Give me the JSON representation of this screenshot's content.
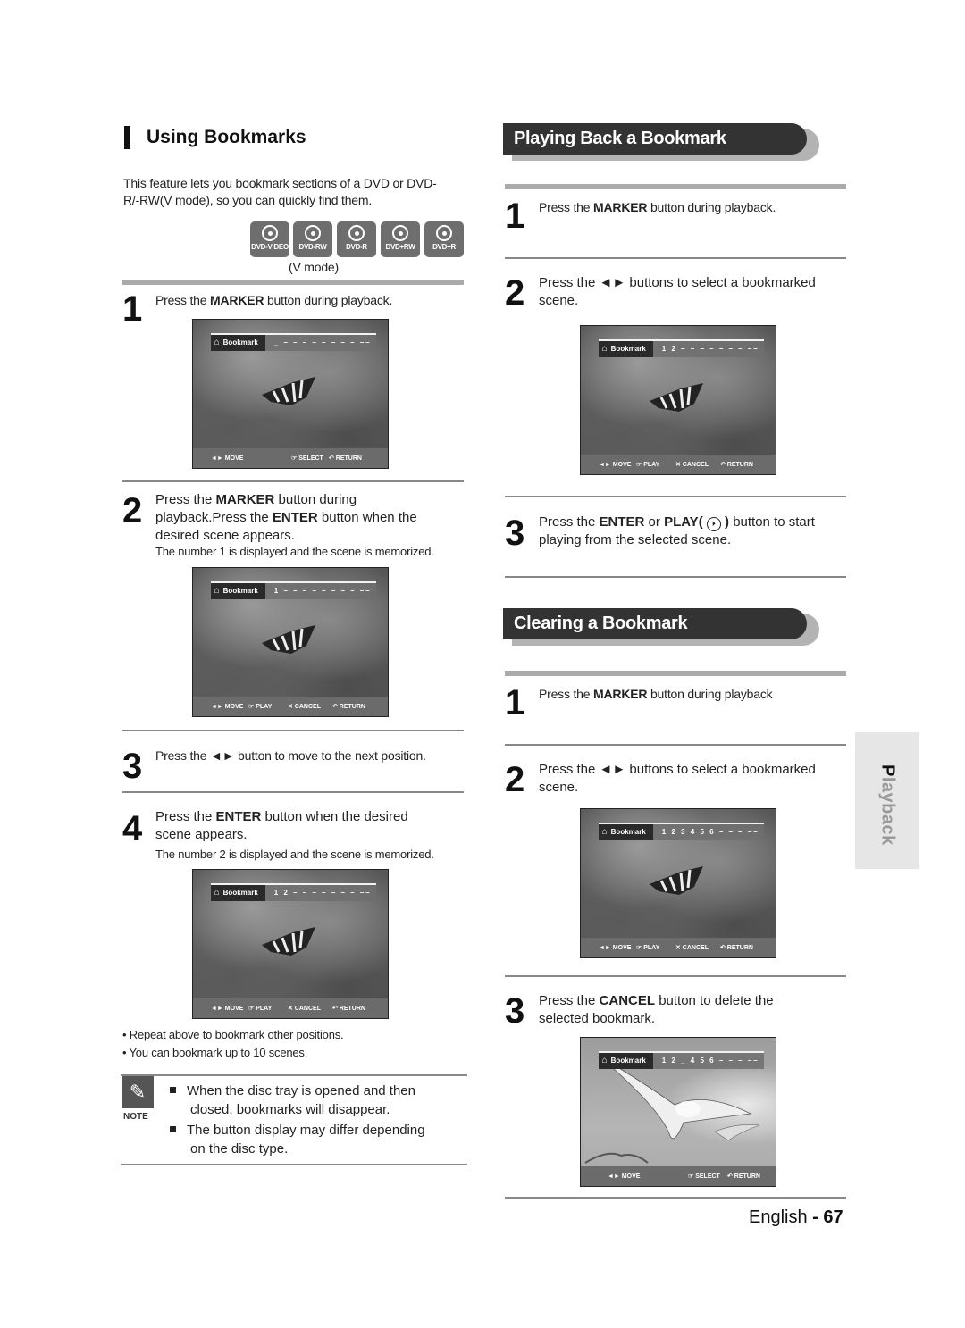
{
  "left": {
    "title": "Using Bookmarks",
    "intro": "This feature lets you bookmark sections of a DVD or DVD-R/-RW(V mode), so you can quickly find them.",
    "intro_line1": "This feature lets you bookmark sections of a DVD or DVD-",
    "intro_line2": "R/-RW(V mode), so you can quickly find them.",
    "disc_types": [
      "DVD-VIDEO",
      "DVD-RW",
      "DVD-R",
      "DVD+RW",
      "DVD+R"
    ],
    "disc_caption": "(V mode)",
    "steps": [
      {
        "num": "1",
        "pre": "Press the ",
        "bold": "MARKER",
        "post": " button during playback."
      },
      {
        "num": "2",
        "line1_pre": "Press the ",
        "line1_bold": "MARKER",
        "line1_post": " button during",
        "line2_pre": "playback.Press the ",
        "line2_bold": "ENTER",
        "line2_post": " button when the",
        "line3": "desired scene appears.",
        "note": "The number 1 is displayed and the scene is memorized."
      },
      {
        "num": "3",
        "pre": "Press the ",
        "arrows": "◄►",
        "post": " button to move to the next position."
      },
      {
        "num": "4",
        "line1_pre": "Press the ",
        "line1_bold": "ENTER",
        "line1_post": " button when the desired",
        "line2": "scene appears.",
        "note": "The number 2 is displayed and the scene is memorized."
      }
    ],
    "bullets": [
      "• Repeat above to bookmark other positions.",
      "• You can bookmark up to 10 scenes."
    ],
    "note_label": "NOTE",
    "notes": [
      {
        "line1": "When the disc tray is opened and then",
        "line2": "closed, bookmarks will disappear."
      },
      {
        "line1": "The button display may differ depending",
        "line2": "on the disc type."
      }
    ]
  },
  "screens": {
    "bookmark_label": "Bookmark",
    "s1": {
      "slots": "_ – – – – – – – – ––",
      "buttons": [
        "◄► MOVE",
        "☞ SELECT",
        "↶ RETURN"
      ]
    },
    "s2": {
      "slots": "1 – – – – – – – – ––",
      "buttons": [
        "◄► MOVE",
        "☞ PLAY",
        "✕ CANCEL",
        "↶ RETURN"
      ]
    },
    "s3": {
      "slots": "1 2 – – – – – – – ––",
      "buttons": [
        "◄► MOVE",
        "☞ PLAY",
        "✕ CANCEL",
        "↶ RETURN"
      ]
    },
    "s4": {
      "slots": "1 2 – – – – – – – ––",
      "buttons": [
        "◄► MOVE",
        "☞ PLAY",
        "✕ CANCEL",
        "↶ RETURN"
      ]
    },
    "s5": {
      "slots": "1 2 3 4 5 6 – – – ––",
      "buttons": [
        "◄► MOVE",
        "☞ PLAY",
        "✕ CANCEL",
        "↶ RETURN"
      ]
    },
    "s6": {
      "slots": "1 2 _ 4 5 6 – – – ––",
      "buttons": [
        "◄► MOVE",
        "☞ SELECT",
        "↶ RETURN"
      ]
    }
  },
  "right": {
    "section1_title": "Playing Back a Bookmark",
    "s1_steps": [
      {
        "num": "1",
        "pre": "Press the ",
        "bold": "MARKER",
        "post": " button during playback."
      },
      {
        "num": "2",
        "line1": "Press the ◄► buttons to select a bookmarked",
        "line2": "scene."
      },
      {
        "num": "3",
        "line1_pre": "Press the ",
        "line1_bold": "ENTER",
        "line1_mid": " or ",
        "line1_bold2": "PLAY(",
        "play_icon": "⏵",
        "line1_bold3": ")",
        "line1_post": " button to start",
        "line2": "playing from the selected scene."
      }
    ],
    "section2_title": "Clearing a Bookmark",
    "s2_steps": [
      {
        "num": "1",
        "pre": "Press the ",
        "bold": "MARKER",
        "post": " button during playback"
      },
      {
        "num": "2",
        "line1": "Press the ◄► buttons to select a bookmarked",
        "line2": "scene."
      },
      {
        "num": "3",
        "line1_pre": "Press the ",
        "line1_bold": "CANCEL",
        "line1_post": " button to delete the",
        "line2": "selected bookmark."
      }
    ]
  },
  "side_tab": {
    "first": "P",
    "rest": "layback"
  },
  "footer": {
    "lang": "English",
    "sep": " - ",
    "page": "67"
  }
}
